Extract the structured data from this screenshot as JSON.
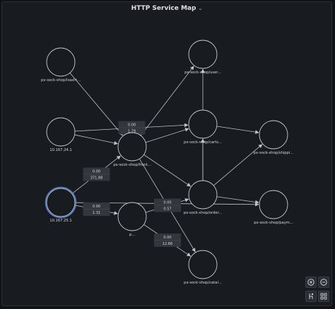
{
  "panel": {
    "title": "HTTP Service Map"
  },
  "colors": {
    "background": "#181b1f",
    "node_stroke": "#c9ccd1",
    "edge": "#bfc2c7",
    "selected_ring": "#5a7fd6",
    "edge_label_bg": "#33363c"
  },
  "nodes": [
    {
      "id": "loadgen",
      "label": "px-sock-shop/load-t..."
    },
    {
      "id": "ip24",
      "label": "10.167.24.1"
    },
    {
      "id": "ip25",
      "label": "10.167.25.1"
    },
    {
      "id": "front",
      "label": "px-sock-shop/front..."
    },
    {
      "id": "hidden",
      "label": "p..."
    },
    {
      "id": "user",
      "label": "px-sock-shop/user..."
    },
    {
      "id": "carts",
      "label": "px-sock-shop/carts..."
    },
    {
      "id": "orders",
      "label": "px-sock-shop/order..."
    },
    {
      "id": "catalogue",
      "label": "px-sock-shop/catal..."
    },
    {
      "id": "shipping",
      "label": "px-sock-shop/shippi..."
    },
    {
      "id": "payment",
      "label": "px-sock-shop/paym..."
    }
  ],
  "edges": [
    {
      "from": "loadgen",
      "to": "front"
    },
    {
      "from": "ip24",
      "to": "carts",
      "labels": [
        "0.00",
        "1.79"
      ]
    },
    {
      "from": "ip24",
      "to": "front"
    },
    {
      "from": "ip25",
      "to": "front",
      "labels": [
        "0.00",
        "371.88"
      ]
    },
    {
      "from": "ip25",
      "to": "hidden",
      "labels": [
        "0.00",
        "1.31"
      ]
    },
    {
      "from": "ip25",
      "to": "payment"
    },
    {
      "from": "front",
      "to": "user"
    },
    {
      "from": "front",
      "to": "carts"
    },
    {
      "from": "front",
      "to": "orders"
    },
    {
      "from": "front",
      "to": "catalogue"
    },
    {
      "from": "hidden",
      "to": "orders",
      "labels": [
        "0.00",
        "0.57"
      ]
    },
    {
      "from": "hidden",
      "to": "catalogue",
      "labels": [
        "0.00",
        "12.66"
      ]
    },
    {
      "from": "carts",
      "to": "shipping"
    },
    {
      "from": "orders",
      "to": "user"
    },
    {
      "from": "orders",
      "to": "carts"
    },
    {
      "from": "orders",
      "to": "shipping"
    },
    {
      "from": "orders",
      "to": "payment"
    }
  ],
  "controls": {
    "zoom_in": "zoom-in-icon",
    "zoom_out": "zoom-out-icon",
    "layout": "hierarchy-icon",
    "grid": "grid-icon"
  }
}
